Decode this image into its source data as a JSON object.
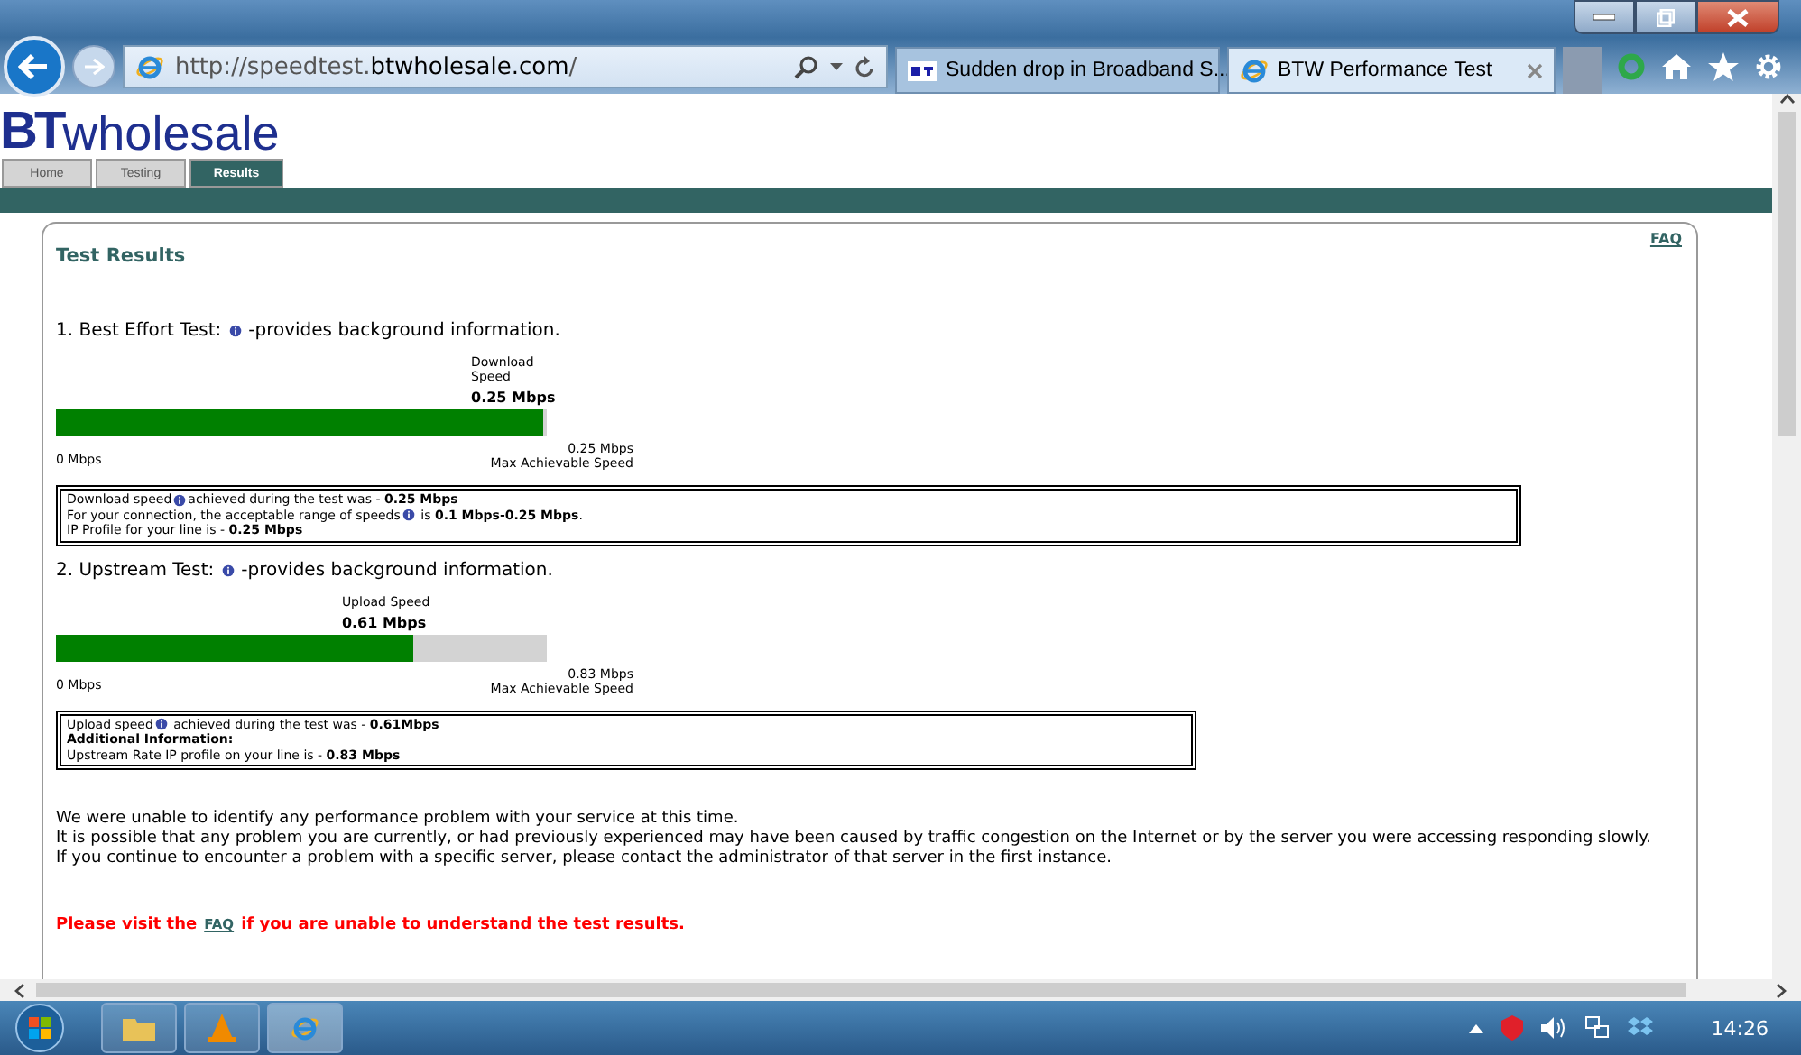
{
  "browser": {
    "address": {
      "prefix": "http://speedtest.",
      "domain": "btwholesale.com",
      "suffix": "/"
    },
    "tabs": [
      {
        "kind": "bt",
        "title": "Sudden drop in Broadband S...",
        "selected": false
      },
      {
        "kind": "ie",
        "title": "BTW Performance Test",
        "selected": true
      }
    ]
  },
  "site": {
    "logo": {
      "mark": "BT",
      "word": "wholesale"
    },
    "nav": [
      {
        "label": "Home",
        "selected": false
      },
      {
        "label": "Testing",
        "selected": false
      },
      {
        "label": "Results",
        "selected": true
      }
    ]
  },
  "results": {
    "title": "Test Results",
    "faq": "FAQ",
    "tests": [
      {
        "heading": "1. Best Effort Test:",
        "hint": "-provides background information.",
        "speed_label": "Download Speed",
        "speed": "0.25 Mbps",
        "level": 1,
        "min": "0 Mbps",
        "max": "0.25 Mbps",
        "max_label": "Max Achievable Speed",
        "lines": [
          {
            "before": "Download speed",
            "info": true,
            "after": "achieved during the test was - **0.25 Mbps**",
            "bold": false
          },
          {
            "before": "For your connection, the acceptable range of speeds",
            "info": true,
            "after": " is **0.1 Mbps-0.25 Mbps**.",
            "bold": false
          },
          {
            "before": "IP Profile for your line is - **0.25 Mbps**",
            "info": false,
            "bold": false
          }
        ]
      },
      {
        "heading": "2. Upstream Test:",
        "hint": "-provides background information.",
        "speed_label": "Upload Speed",
        "speed": "0.61 Mbps",
        "level": 0.735,
        "min": "0 Mbps",
        "max": "0.83 Mbps",
        "max_label": "Max Achievable Speed",
        "lines": [
          {
            "before": "Upload speed",
            "info": true,
            "after": " achieved during the test was - **0.61Mbps**",
            "bold": false
          },
          {
            "before": "Additional Information:",
            "info": false,
            "bold": true
          },
          {
            "before": "Upstream Rate IP profile on your line is - **0.83 Mbps**",
            "info": false,
            "bold": false
          }
        ]
      }
    ],
    "messages": [
      "We were unable to identify any performance problem with your service at this time.",
      "It is possible that any problem you are currently, or had previously experienced may have been caused by traffic congestion on the Internet or by the server you were accessing responding slowly.",
      "If you continue to encounter a problem with a specific server, please contact the administrator of that server in the first instance."
    ],
    "notice": {
      "before": "Please visit the",
      "link": "FAQ",
      "after": "if you are unable to understand the test results."
    }
  },
  "taskbar": {
    "clock": "14:26"
  }
}
